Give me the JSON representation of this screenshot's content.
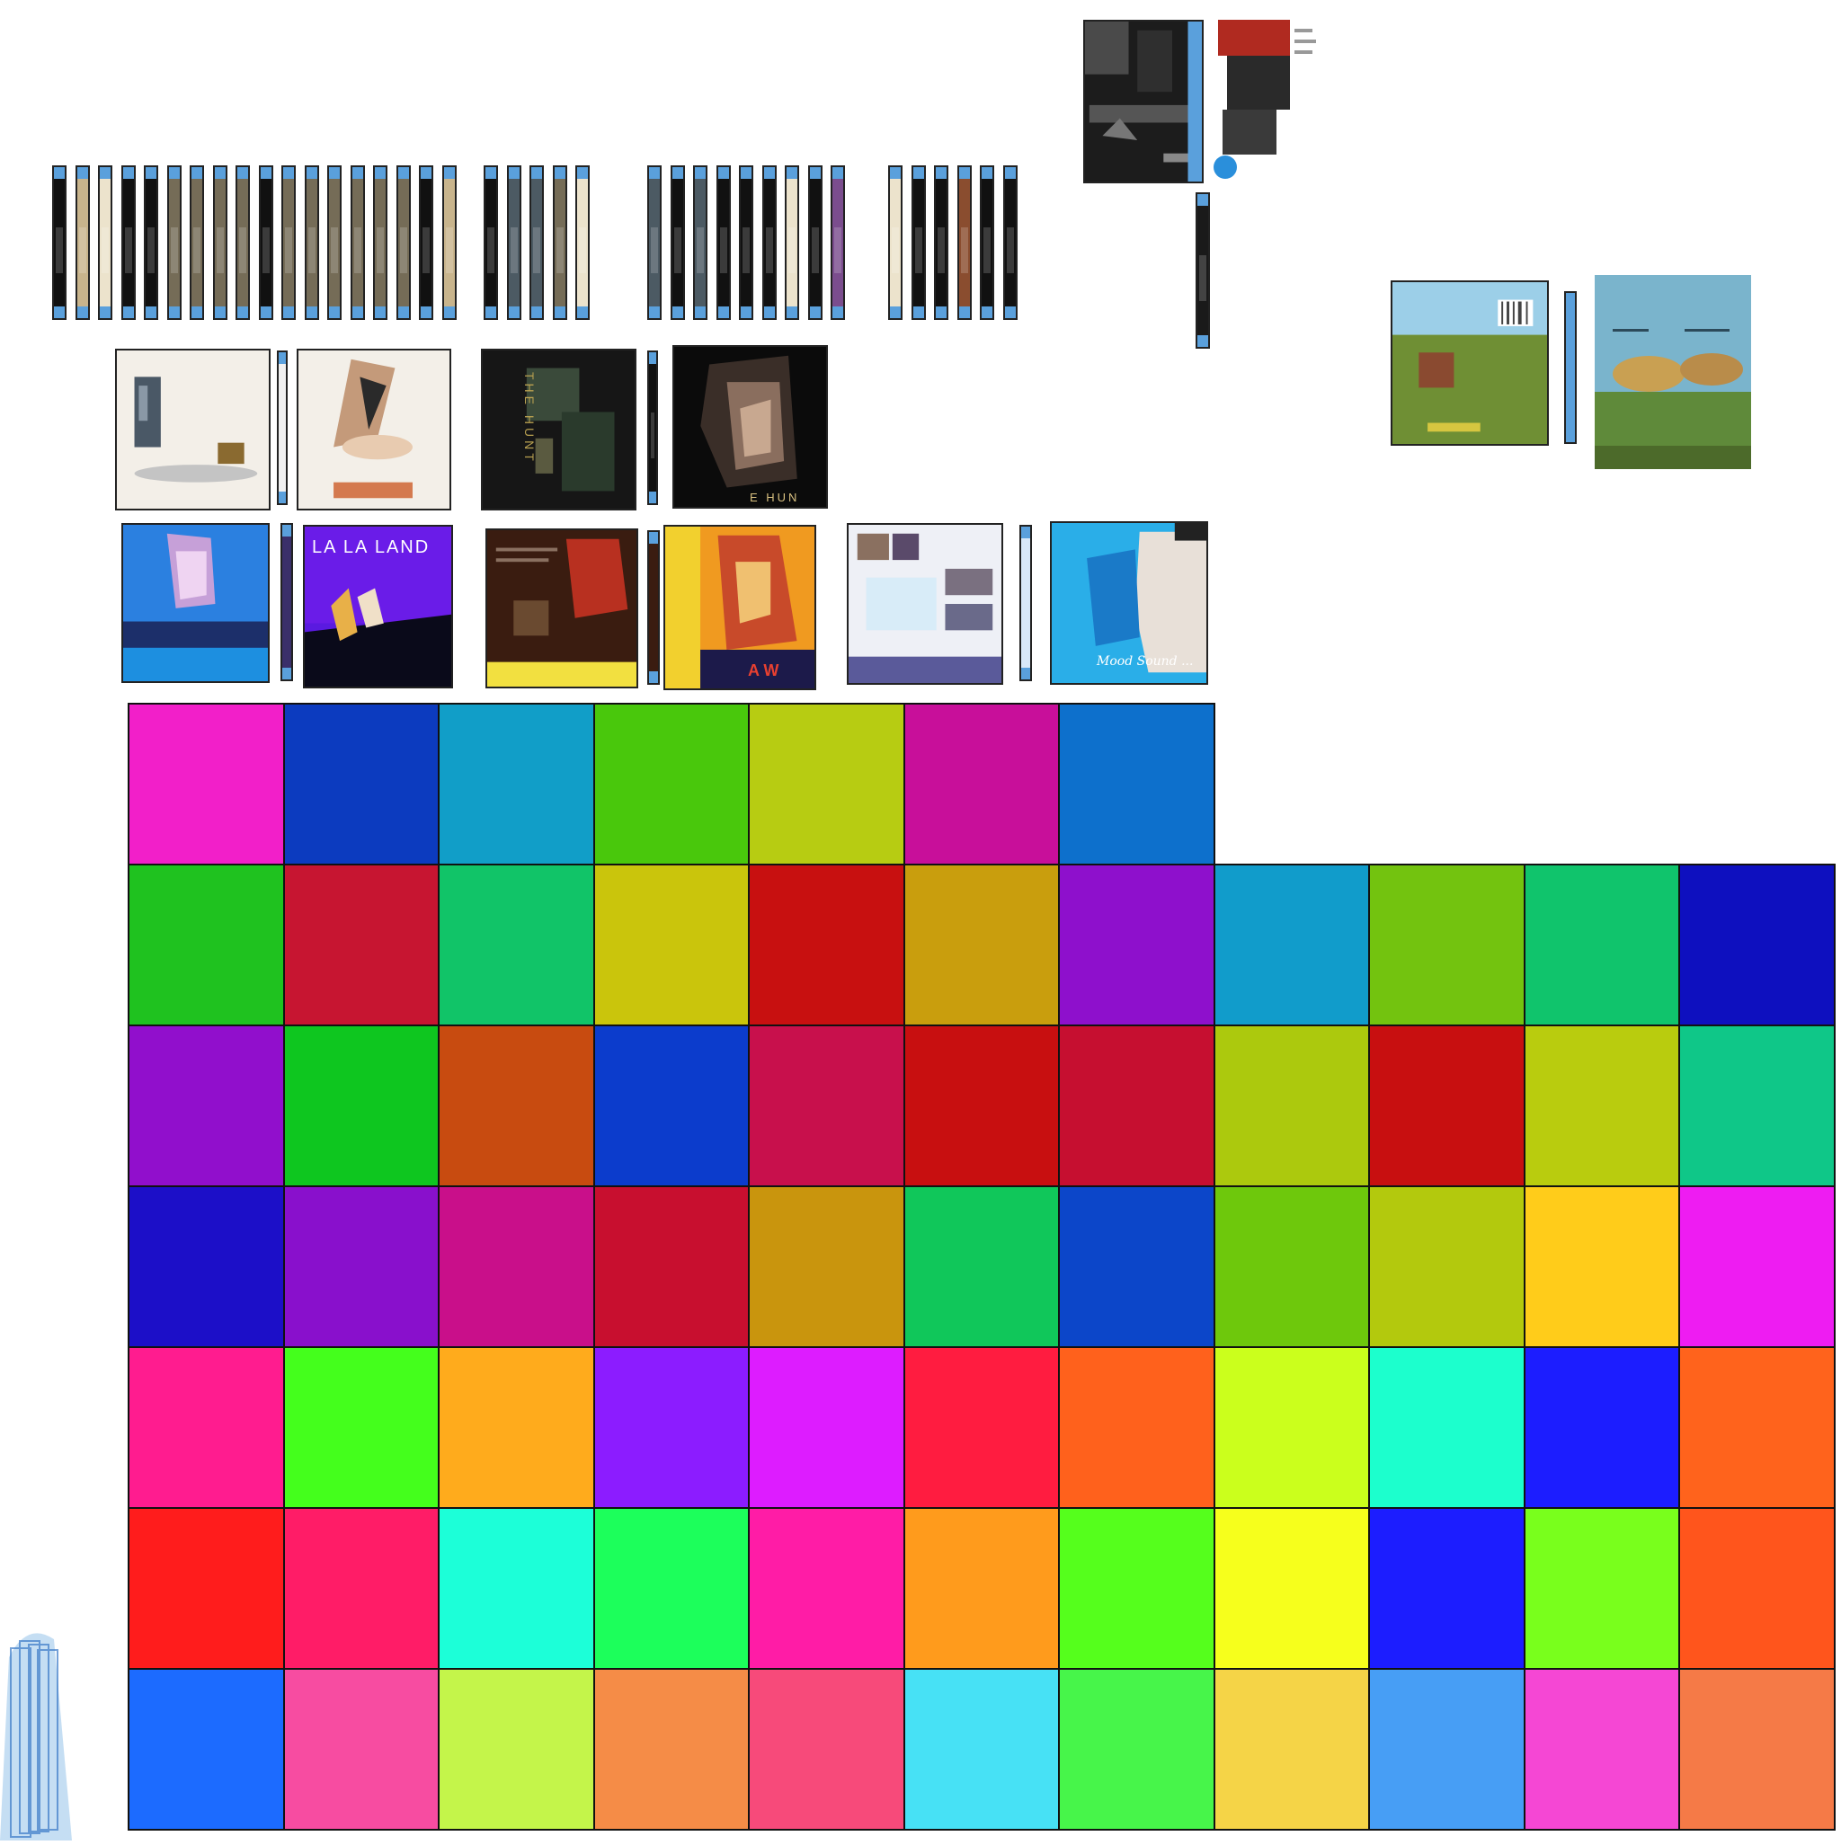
{
  "spine_colors": {
    "cap": "#5aa0dc",
    "dark": "#111111",
    "tan": "#c8b48c",
    "cream": "#ece3cc",
    "grey": "#5a5a5a",
    "olive": "#756c57",
    "slate": "#4c5a63",
    "purple": "#7b4d8e",
    "rust": "#8a4d2f"
  },
  "covers": [
    {
      "name": "cover-glass-still-life",
      "bg": "#f3efe8"
    },
    {
      "name": "cover-abstract-shapes",
      "bg": "#f3efe8"
    },
    {
      "name": "cover-the-hunt-back",
      "bg": "#111111",
      "title": "THE HUNT"
    },
    {
      "name": "cover-the-hunt-front",
      "bg": "#0b0b0b",
      "title": "E HUN"
    },
    {
      "name": "cover-blue-portrait",
      "bg": "#1f6fd4"
    },
    {
      "name": "cover-la-la-land",
      "bg": "#5a1ae0",
      "title": "LA LA LAND"
    },
    {
      "name": "cover-yellow-red-back",
      "bg": "#3a1c10"
    },
    {
      "name": "cover-yellow-red-front",
      "bg": "#f2d02e",
      "title": "A W"
    },
    {
      "name": "cover-collage-back",
      "bg": "#eef0f6"
    },
    {
      "name": "cover-kiss-blue",
      "bg": "#2aaee8",
      "title": "Mood Sound ..."
    },
    {
      "name": "cover-top-dark",
      "bg": "#2a2a2a"
    },
    {
      "name": "cover-top-red",
      "bg": "#ffffff"
    },
    {
      "name": "cover-landscape-back",
      "bg": "#7aa63a"
    },
    {
      "name": "cover-landscape-front",
      "bg": "#7ab4cc"
    }
  ],
  "palette_rows": [
    [
      "#f21fc9",
      "#0c3bbf",
      "#119ec8",
      "#49c80c",
      "#b7cc12",
      "#c80f9a",
      "#0d70cc"
    ],
    [
      "#1fc21f",
      "#c71531",
      "#11c468",
      "#cac50c",
      "#c81010",
      "#c99e0d",
      "#8e10cc",
      "#119ccb",
      "#73c30f",
      "#10c46c",
      "#0e10bf"
    ],
    [
      "#910fcc",
      "#0ec61f",
      "#c84b10",
      "#0c3ccc",
      "#c8104c",
      "#c80f10",
      "#c60f30",
      "#acc90d",
      "#c80f10",
      "#b9cc0e",
      "#0fc788"
    ],
    [
      "#1c0fc8",
      "#8910cc",
      "#c90f8a",
      "#c80f2f",
      "#c9950d",
      "#10c75a",
      "#0c46c9",
      "#6ec80c",
      "#b3c90d",
      "#ffcc1a",
      "#ee1cf2"
    ],
    [
      "#ff1c8f",
      "#44ff1c",
      "#ffab1c",
      "#8c1cff",
      "#dd1cff",
      "#ff1c40",
      "#ff611c",
      "#cbff1c",
      "#1cffcd",
      "#1c1dff",
      "#ff631c"
    ],
    [
      "#ff1c1c",
      "#ff1c67",
      "#1cffd8",
      "#1cff5b",
      "#ff1ca6",
      "#ff9b1c",
      "#55ff1c",
      "#f6ff1c",
      "#1c1dff",
      "#79ff1c",
      "#ff551c"
    ],
    [
      "#1c6bff",
      "#f74ca1",
      "#c4f54a",
      "#f58c47",
      "#f74a7a",
      "#47e1f5",
      "#47f54a",
      "#f5d447",
      "#479ef5",
      "#f547d4",
      "#f57a47"
    ]
  ]
}
